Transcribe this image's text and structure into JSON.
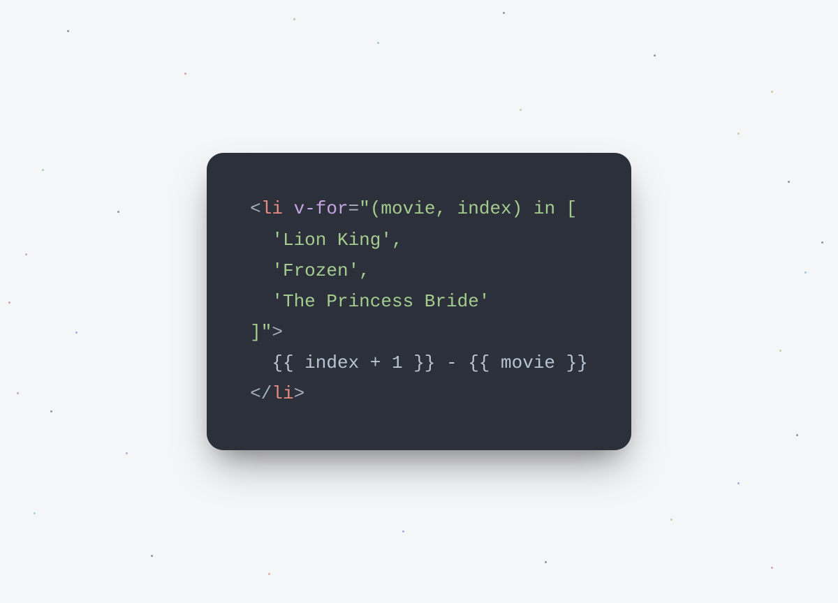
{
  "code": {
    "line1_bracket_open": "<",
    "line1_tag": "li",
    "line1_space": " ",
    "line1_attr": "v-for",
    "line1_eq": "=",
    "line1_str": "\"(movie, index) in [",
    "line2_str": "  'Lion King',",
    "line3_str": "  'Frozen',",
    "line4_str": "  'The Princess Bride'",
    "line5_str": "]\"",
    "line5_bracket_close": ">",
    "line6_text": "  {{ index + 1 }} - {{ movie }}",
    "line7_bracket_open": "</",
    "line7_tag": "li",
    "line7_bracket_close": ">"
  }
}
